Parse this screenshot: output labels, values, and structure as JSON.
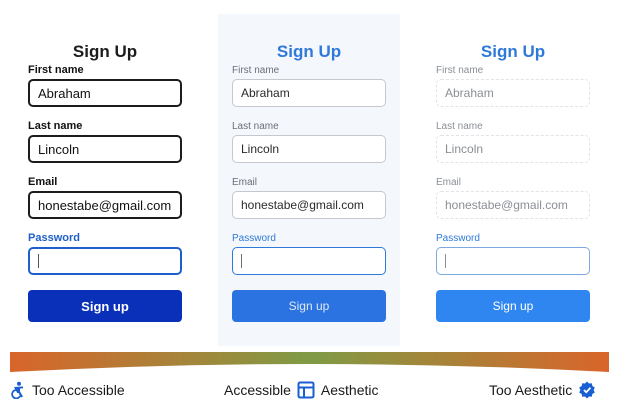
{
  "panels": [
    {
      "title": "Sign Up",
      "first_name_label": "First name",
      "first_name_value": "Abraham",
      "last_name_label": "Last name",
      "last_name_value": "Lincoln",
      "email_label": "Email",
      "email_value": "honestabe@gmail.com",
      "password_label": "Password",
      "button_label": "Sign up"
    },
    {
      "title": "Sign Up",
      "first_name_label": "First name",
      "first_name_value": "Abraham",
      "last_name_label": "Last name",
      "last_name_value": "Lincoln",
      "email_label": "Email",
      "email_value": "honestabe@gmail.com",
      "password_label": "Password",
      "button_label": "Sign up"
    },
    {
      "title": "Sign Up",
      "first_name_label": "First name",
      "first_name_value": "Abraham",
      "last_name_label": "Last name",
      "last_name_value": "Lincoln",
      "email_label": "Email",
      "email_value": "honestabe@gmail.com",
      "password_label": "Password",
      "button_label": "Sign up"
    }
  ],
  "scale": {
    "left_label": "Too Accessible",
    "middle_label_1": "Accessible",
    "middle_label_2": "Aesthetic",
    "right_label": "Too Aesthetic",
    "left_icon": "accessibility-icon",
    "middle_icon": "layout-icon",
    "right_icon": "badge-icon",
    "gradient_colors": [
      "#d9652a",
      "#7f9b45",
      "#d9652a"
    ]
  }
}
